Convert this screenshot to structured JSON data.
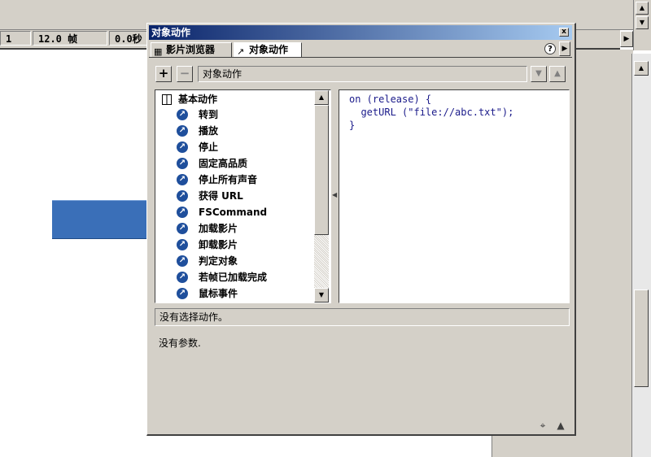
{
  "statusbar": {
    "frame_number": "1",
    "frame_rate": "12.0 帧",
    "elapsed_time": "0.0秒"
  },
  "panel": {
    "title": "对象动作",
    "close_label": "x",
    "tabs": [
      {
        "label": "影片浏览器",
        "active": false,
        "icon": "movie-explorer-icon"
      },
      {
        "label": "对象动作",
        "active": true,
        "icon": "object-actions-icon"
      }
    ],
    "help_label": "?",
    "toolbar": {
      "add_label": "+",
      "remove_label": "−",
      "field_value": "对象动作"
    },
    "action_list": {
      "category": "基本动作",
      "items": [
        "转到",
        "播放",
        "停止",
        "固定高品质",
        "停止所有声音",
        "获得 URL",
        "FSCommand",
        "加载影片",
        "卸载影片",
        "判定对象",
        "若帧已加载完成",
        "鼠标事件"
      ]
    },
    "code_text": "on (release) {\n  getURL (\"file://abc.txt\");\n}",
    "status_text": "没有选择动作。",
    "params_text": "没有参数."
  },
  "colors": {
    "chrome": "#d4d0c8",
    "titlebar_start": "#0a246a",
    "titlebar_end": "#a6caf0",
    "action_bullet": "#1f4f9c",
    "code_text": "#1a1a8a",
    "stage_button": "#3a6fb8"
  }
}
